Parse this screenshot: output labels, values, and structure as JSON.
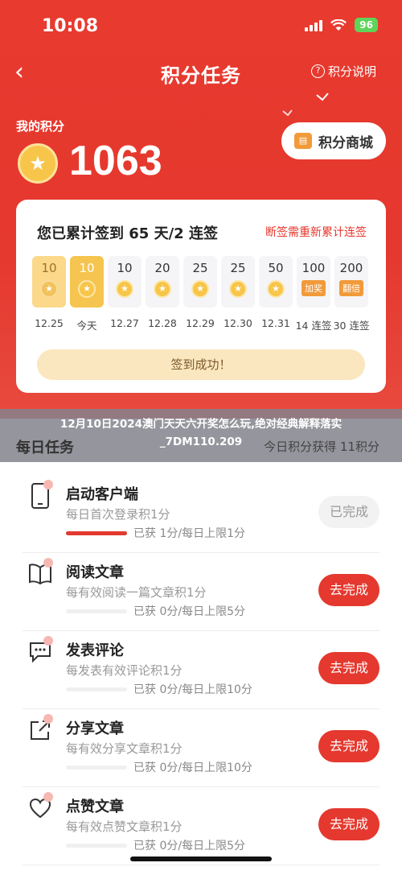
{
  "status_bar": {
    "time": "10:08",
    "battery": "96"
  },
  "nav": {
    "back_icon": "chevron-left-icon",
    "title": "积分任务",
    "help_label": "积分说明"
  },
  "points": {
    "label": "我的积分",
    "value": "1063"
  },
  "mall": {
    "label": "积分商城"
  },
  "checkin": {
    "title": "您已累计签到 65 天/2 连签",
    "hint": "断签需重新累计连签",
    "days": [
      {
        "points": "10",
        "date": "12.25",
        "state": "done",
        "tag": ""
      },
      {
        "points": "10",
        "date": "今天",
        "state": "today",
        "tag": ""
      },
      {
        "points": "10",
        "date": "12.27",
        "state": "future",
        "tag": ""
      },
      {
        "points": "20",
        "date": "12.28",
        "state": "future",
        "tag": ""
      },
      {
        "points": "25",
        "date": "12.29",
        "state": "future",
        "tag": ""
      },
      {
        "points": "25",
        "date": "12.30",
        "state": "future",
        "tag": ""
      },
      {
        "points": "50",
        "date": "12.31",
        "state": "future",
        "tag": ""
      },
      {
        "points": "100",
        "date": "14 连签",
        "state": "future",
        "tag": "加奖"
      },
      {
        "points": "200",
        "date": "30 连签",
        "state": "future",
        "tag": "翻倍"
      }
    ],
    "button": "签到成功！"
  },
  "overlay_banner": "12月10日2024澳门天天六开奖怎么玩,绝对经典解释落实_7DM110.209",
  "daily": {
    "title": "每日任务",
    "today_label": "今日积分获得 11积分"
  },
  "tasks": [
    {
      "icon": "phone-icon",
      "title": "启动客户端",
      "desc": "每日首次登录积1分",
      "progress": "已获 1分/每日上限1分",
      "fill": 1.0,
      "button": "已完成",
      "state": "done"
    },
    {
      "icon": "book-icon",
      "title": "阅读文章",
      "desc": "每有效阅读一篇文章积1分",
      "progress": "已获 0分/每日上限5分",
      "fill": 0.0,
      "button": "去完成",
      "state": "todo"
    },
    {
      "icon": "comment-icon",
      "title": "发表评论",
      "desc": "每发表有效评论积1分",
      "progress": "已获 0分/每日上限10分",
      "fill": 0.0,
      "button": "去完成",
      "state": "todo"
    },
    {
      "icon": "share-icon",
      "title": "分享文章",
      "desc": "每有效分享文章积1分",
      "progress": "已获 0分/每日上限10分",
      "fill": 0.0,
      "button": "去完成",
      "state": "todo"
    },
    {
      "icon": "heart-icon",
      "title": "点赞文章",
      "desc": "每有效点赞文章积1分",
      "progress": "已获 0分/每日上限5分",
      "fill": 0.0,
      "button": "去完成",
      "state": "todo"
    }
  ]
}
